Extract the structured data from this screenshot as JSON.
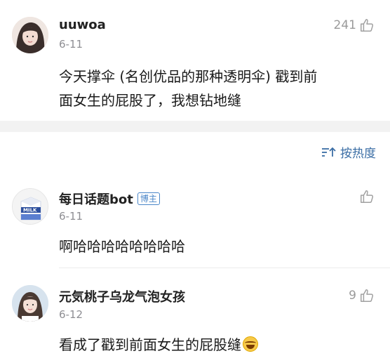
{
  "main_post": {
    "username": "uuwoa",
    "date": "6-11",
    "like_count": "241",
    "text_line1": "今天撑伞 (名创优品的那种透明伞) 戳到前",
    "text_line2": "面女生的屁股了，我想钻地缝",
    "avatar_icon": "user-avatar-icon"
  },
  "sort": {
    "label": "按热度",
    "icon": "sort-icon"
  },
  "comments": [
    {
      "username": "每日话题bot",
      "badge": "博主",
      "date": "6-11",
      "like_count": "",
      "text": "啊哈哈哈哈哈哈哈哈",
      "avatar_icon": "milk-carton-avatar-icon"
    },
    {
      "username": "元気桃子乌龙气泡女孩",
      "date": "6-12",
      "like_count": "9",
      "text": "看成了戳到前面女生的屁股缝",
      "emoji_icon": "laughing-crying-emoji-icon",
      "avatar_icon": "user-avatar-icon"
    }
  ],
  "colors": {
    "link_blue": "#3b6ea5",
    "badge_blue": "#4a86c8",
    "muted_gray": "#8e8e93",
    "divider_band": "#f2f2f2"
  }
}
